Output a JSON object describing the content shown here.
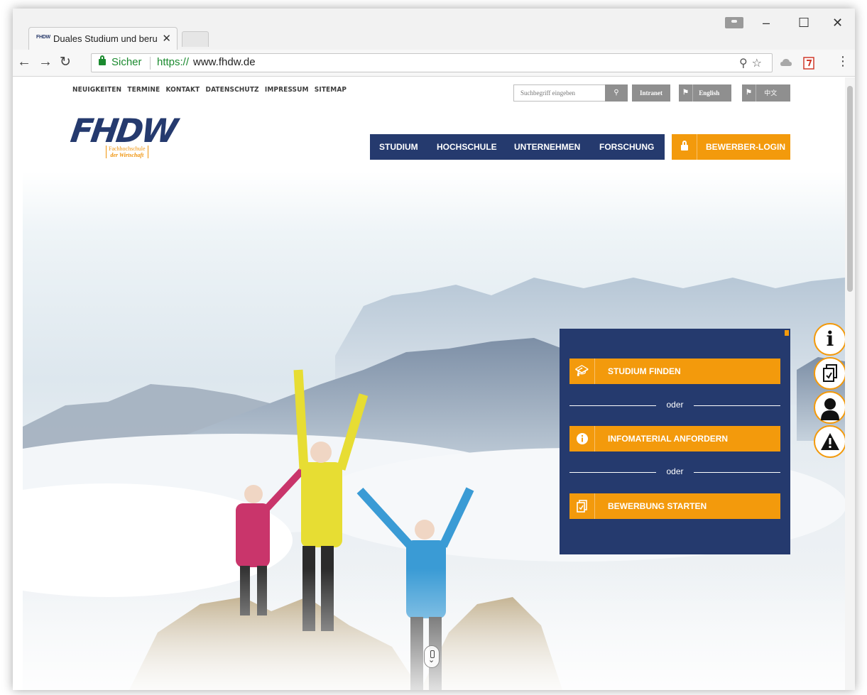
{
  "browser": {
    "tab_title": "Duales Studium und beru",
    "tab_favicon": "FHDW",
    "secure_label": "Sicher",
    "url_scheme": "https://",
    "url_host": "www.fhdw.de",
    "window_controls": [
      "–",
      "☐",
      "✕"
    ]
  },
  "utility": {
    "links": [
      "NEUIGKEITEN",
      "TERMINE",
      "KONTAKT",
      "DATENSCHUTZ",
      "IMPRESSUM",
      "SITEMAP"
    ],
    "search_placeholder": "Suchbegriff eingeben",
    "intranet": "Intranet",
    "english": "English",
    "chinese": "中文"
  },
  "logo": {
    "text": "FHDW",
    "sub_line1": "Fachhochschule",
    "sub_line2": "der Wirtschaft"
  },
  "nav": {
    "items": [
      "STUDIUM",
      "HOCHSCHULE",
      "UNTERNEHMEN",
      "FORSCHUNG"
    ],
    "login": "BEWERBER-LOGIN"
  },
  "panel": {
    "btn1": "STUDIUM FINDEN",
    "or1": "oder",
    "btn2": "INFOMATERIAL ANFORDERN",
    "or2": "oder",
    "btn3": "BEWERBUNG STARTEN"
  },
  "side_icons": [
    "info-icon",
    "document-icon",
    "person-icon",
    "warning-icon"
  ],
  "colors": {
    "brand_blue": "#253a6e",
    "brand_orange": "#f39a0c",
    "secure_green": "#1b8a2f"
  }
}
